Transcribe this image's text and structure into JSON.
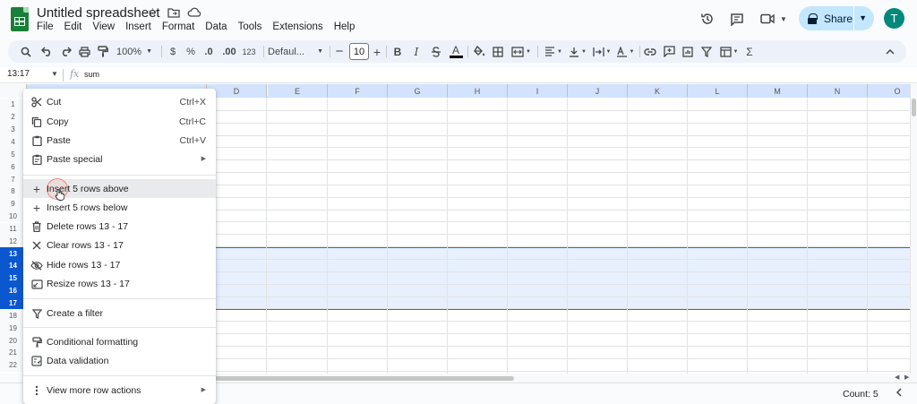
{
  "app": {
    "title": "Untitled spreadsheet",
    "accent": "#0b57d0",
    "share_bg": "#c2e7ff",
    "brand_green": "#188038"
  },
  "menus": [
    "File",
    "Edit",
    "View",
    "Insert",
    "Format",
    "Data",
    "Tools",
    "Extensions",
    "Help"
  ],
  "header": {
    "share_label": "Share",
    "avatar_letter": "T"
  },
  "toolbar": {
    "zoom": "100%",
    "currency": "$",
    "percent": "%",
    "dec_decrease": ".0",
    "dec_increase": ".00",
    "number_format": "123",
    "font": "Defaul...",
    "font_size": "10",
    "bold": "B",
    "italic": "I"
  },
  "formula_bar": {
    "name_box": "13:17",
    "fx": "fx",
    "formula": "sum"
  },
  "columns": [
    "D",
    "E",
    "F",
    "G",
    "H",
    "I",
    "J",
    "K",
    "L",
    "M",
    "N",
    "O"
  ],
  "rows": [
    "1",
    "2",
    "3",
    "4",
    "5",
    "6",
    "7",
    "8",
    "9",
    "10",
    "11",
    "12",
    "13",
    "14",
    "15",
    "16",
    "17",
    "18",
    "19",
    "20",
    "21",
    "22"
  ],
  "selected_rows": [
    "13",
    "14",
    "15",
    "16",
    "17"
  ],
  "context_menu": {
    "cut": {
      "label": "Cut",
      "shortcut": "Ctrl+X"
    },
    "copy": {
      "label": "Copy",
      "shortcut": "Ctrl+C"
    },
    "paste": {
      "label": "Paste",
      "shortcut": "Ctrl+V"
    },
    "paste_special": {
      "label": "Paste special"
    },
    "insert_above": {
      "label": "Insert 5 rows above"
    },
    "insert_below": {
      "label": "Insert 5 rows below"
    },
    "delete_rows": {
      "label": "Delete rows 13 - 17"
    },
    "clear_rows": {
      "label": "Clear rows 13 - 17"
    },
    "hide_rows": {
      "label": "Hide rows 13 - 17"
    },
    "resize_rows": {
      "label": "Resize rows 13 - 17"
    },
    "create_filter": {
      "label": "Create a filter"
    },
    "conditional_formatting": {
      "label": "Conditional formatting"
    },
    "data_validation": {
      "label": "Data validation"
    },
    "more_row_actions": {
      "label": "View more row actions"
    }
  },
  "status": {
    "count": "Count: 5"
  }
}
